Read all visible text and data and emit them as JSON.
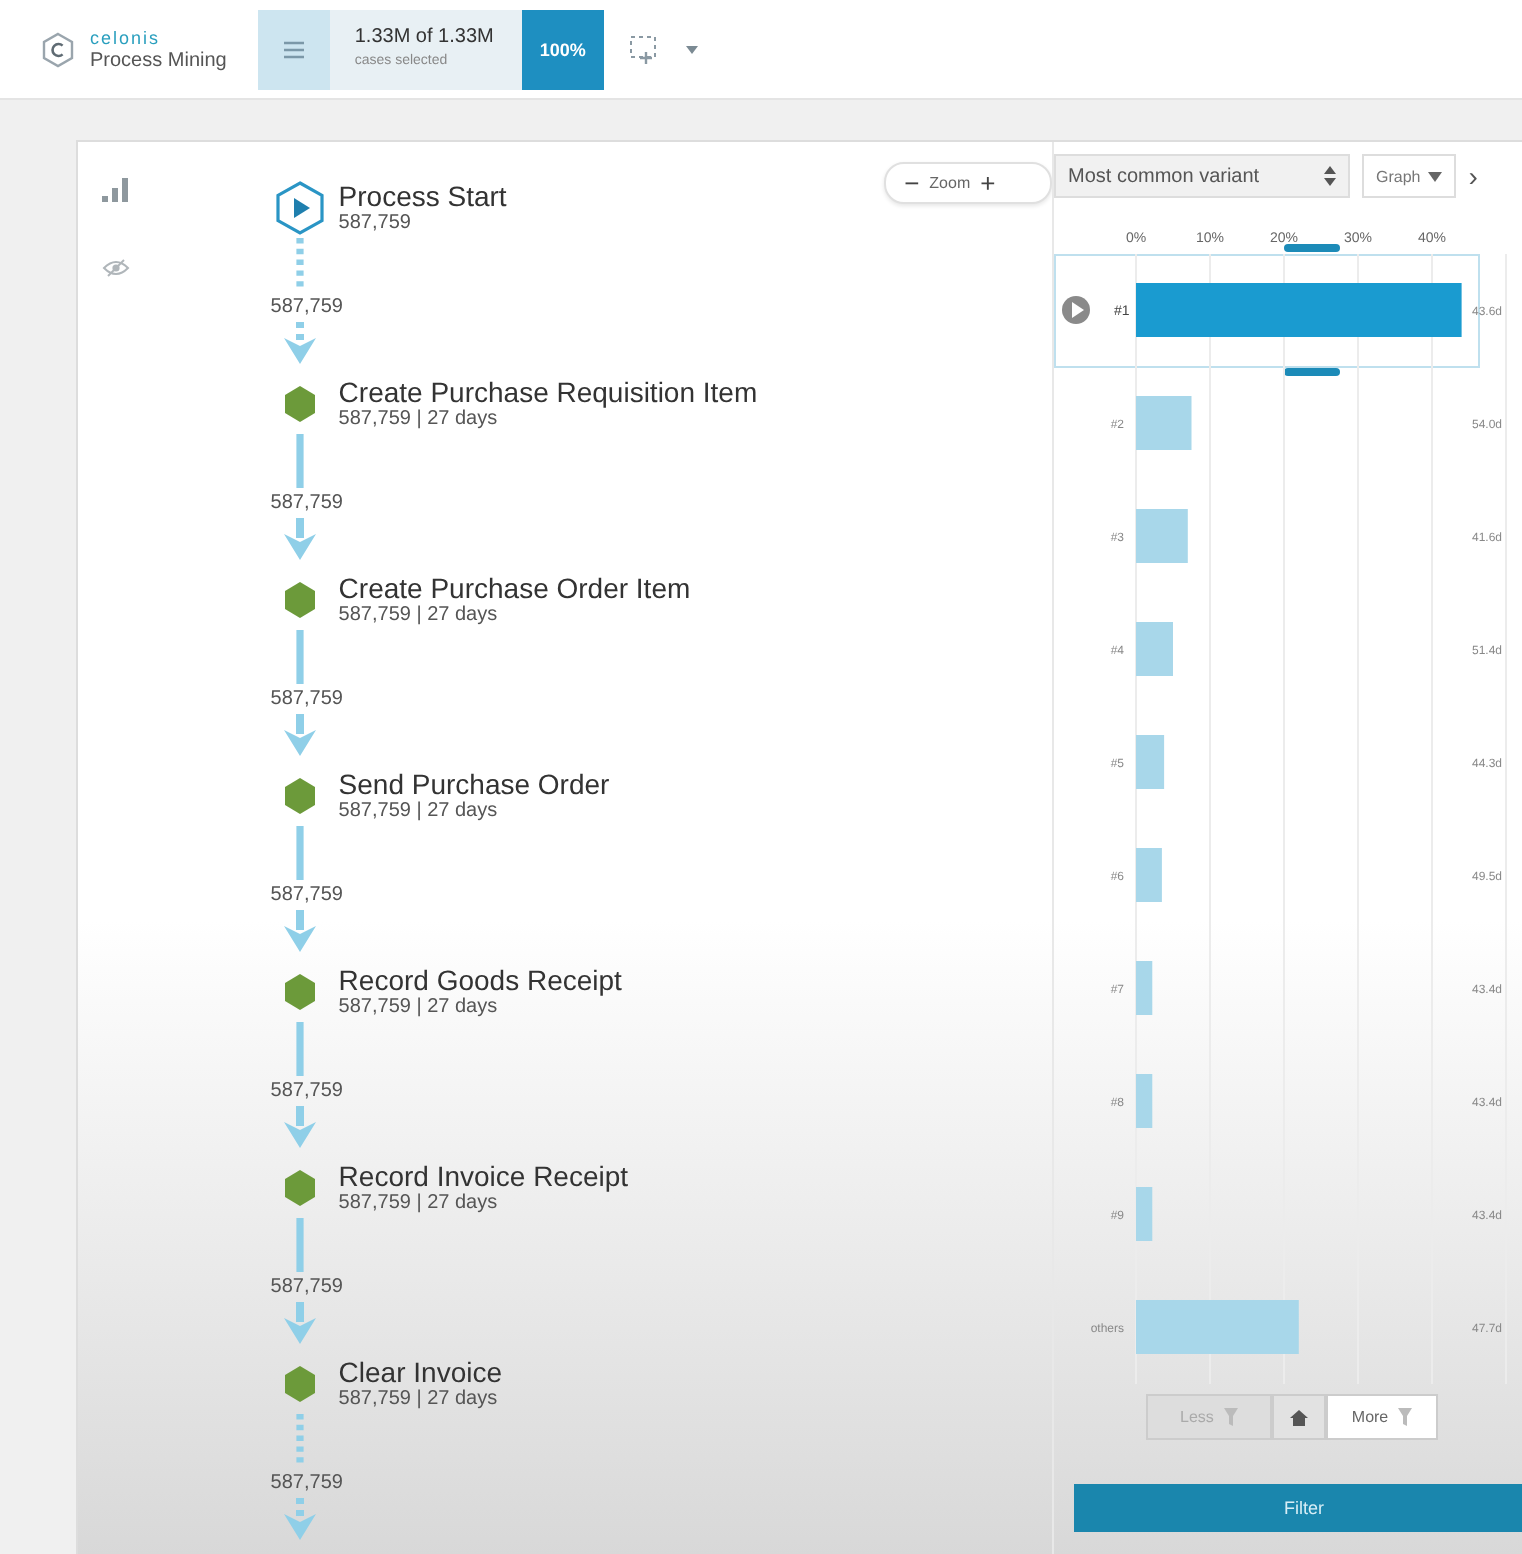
{
  "header": {
    "brand": "celonis",
    "product": "Process Mining",
    "menu_selected": true,
    "cases": "1.33M of 1.33M",
    "cases_caption": "cases selected",
    "share": "100%"
  },
  "zoom": {
    "label": "Zoom",
    "minus": "−",
    "plus": "+"
  },
  "nodes": [
    {
      "kind": "start",
      "name": "Process Start",
      "stats": "587,759"
    },
    {
      "kind": "activity",
      "name": "Create Purchase Requisition Item",
      "stats": "587,759 | 27 days"
    },
    {
      "kind": "activity",
      "name": "Create Purchase Order Item",
      "stats": "587,759 | 27 days"
    },
    {
      "kind": "activity",
      "name": "Send Purchase Order",
      "stats": "587,759 | 27 days"
    },
    {
      "kind": "activity",
      "name": "Record Goods Receipt",
      "stats": "587,759 | 27 days"
    },
    {
      "kind": "activity",
      "name": "Record Invoice Receipt",
      "stats": "587,759 | 27 days"
    },
    {
      "kind": "activity",
      "name": "Clear Invoice",
      "stats": "587,759 | 27 days"
    }
  ],
  "edges": [
    {
      "label": "587,759",
      "kind": "dashed"
    },
    {
      "label": "587,759",
      "kind": "solid"
    },
    {
      "label": "587,759",
      "kind": "solid"
    },
    {
      "label": "587,759",
      "kind": "solid"
    },
    {
      "label": "587,759",
      "kind": "solid"
    },
    {
      "label": "587,759",
      "kind": "solid"
    },
    {
      "label": "587,759",
      "kind": "dashed"
    }
  ],
  "variants_panel": {
    "selector": "Most common variant",
    "view_button": "Graph",
    "next": "›",
    "chart_data": {
      "type": "bar",
      "orientation": "horizontal",
      "categories": [
        "#1",
        "#2",
        "#3",
        "#4",
        "#5",
        "#6",
        "#7",
        "#8",
        "#9",
        "others"
      ],
      "values": [
        44,
        7.5,
        7,
        5,
        3.8,
        3.5,
        2.2,
        2.2,
        2.2,
        22
      ],
      "xlim": [
        0,
        50
      ],
      "grid": true,
      "xticks": [
        {
          "value": 0,
          "label": "0%"
        },
        {
          "value": 10,
          "label": "10%"
        },
        {
          "value": 20,
          "label": "20%"
        },
        {
          "value": 30,
          "label": "30%"
        },
        {
          "value": 40,
          "label": "40%"
        }
      ]
    },
    "rows": [
      {
        "duration": "43.6d",
        "selected": true
      },
      {
        "duration": "54.0d",
        "selected": false
      },
      {
        "duration": "41.6d",
        "selected": false
      },
      {
        "duration": "51.4d",
        "selected": false
      },
      {
        "duration": "44.3d",
        "selected": false
      },
      {
        "duration": "49.5d",
        "selected": false
      },
      {
        "duration": "43.4d",
        "selected": false
      },
      {
        "duration": "43.4d",
        "selected": false
      },
      {
        "duration": "43.4d",
        "selected": false
      },
      {
        "duration": "47.7d",
        "selected": false
      }
    ],
    "less": {
      "label": "Less",
      "disabled": true
    },
    "more": {
      "label": "More",
      "disabled": false
    },
    "filter": "Filter"
  }
}
